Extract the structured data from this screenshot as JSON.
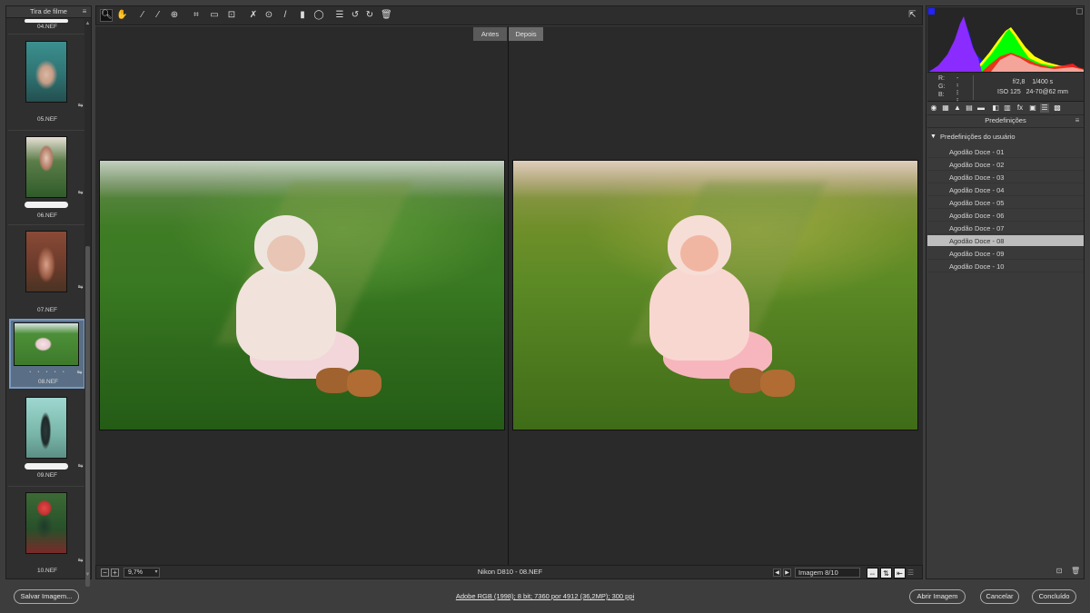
{
  "filmstrip": {
    "title": "Tira de filme",
    "items": [
      {
        "name": "04.NEF"
      },
      {
        "name": "05.NEF"
      },
      {
        "name": "06.NEF"
      },
      {
        "name": "07.NEF"
      },
      {
        "name": "08.NEF",
        "rating_dots": "• • • • •"
      },
      {
        "name": "09.NEF"
      },
      {
        "name": "10.NEF"
      }
    ]
  },
  "toolbar": {
    "tools": [
      "zoom-icon",
      "hand-icon",
      "white-balance-icon",
      "color-sampler-icon",
      "targeted-adjustment-icon",
      "crop-icon",
      "straighten-icon",
      "transform-icon",
      "spot-removal-icon",
      "red-eye-icon",
      "adjustment-brush-icon",
      "graduated-filter-icon",
      "radial-filter-icon",
      "preferences-icon",
      "rotate-left-icon",
      "rotate-right-icon",
      "trash-icon"
    ]
  },
  "preview": {
    "before_label": "Antes",
    "after_label": "Depois"
  },
  "statusbar": {
    "zoom": "9,7%",
    "camera": "Nikon D810  -  08.NEF",
    "image_counter": "Imagem 8/10"
  },
  "metadata": {
    "r_label": "R:",
    "g_label": "G:",
    "b_label": "B:",
    "r_value": "---",
    "g_value": "---",
    "b_value": "---",
    "aperture": "f/2,8",
    "shutter": "1/400 s",
    "iso": "ISO 125",
    "lens": "24-70@62 mm"
  },
  "panel": {
    "title": "Predefinições",
    "group": "Predefinições do usuário",
    "presets": [
      "Agodão Doce - 01",
      "Agodão Doce - 02",
      "Agodão Doce - 03",
      "Agodão Doce - 04",
      "Agodão Doce - 05",
      "Agodão Doce - 06",
      "Agodão Doce - 07",
      "Agodão Doce - 08",
      "Agodão Doce - 09",
      "Agodão Doce - 10"
    ],
    "selected_index": 7
  },
  "bottom": {
    "save_label": "Salvar Imagem...",
    "workflow": "Adobe RGB (1998); 8 bit; 7360 por 4912 (36,2MP); 300 ppi",
    "open_label": "Abrir Imagem",
    "cancel_label": "Cancelar",
    "done_label": "Concluído"
  },
  "colors": {
    "accent_selected": "#7a9ac0",
    "preset_selected": "#bdbdbd"
  }
}
